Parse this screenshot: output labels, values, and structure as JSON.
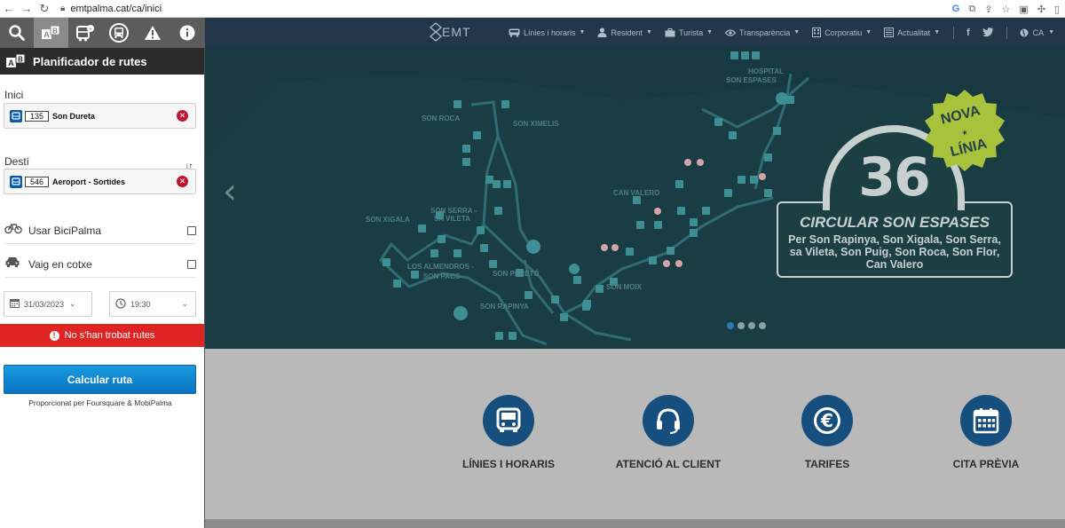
{
  "browser": {
    "url": "emtpalma.cat/ca/inici"
  },
  "panel": {
    "title": "Planificador de rutes",
    "origin": {
      "label": "Inici",
      "code": "135",
      "name": "Son Dureta"
    },
    "destination": {
      "label": "Destí",
      "code": "546",
      "name": "Aeroport - Sortides"
    },
    "options": [
      {
        "label": "Usar BiciPalma",
        "icon": "bicycle-icon"
      },
      {
        "label": "Vaig en cotxe",
        "icon": "car-icon"
      }
    ],
    "date": "31/03/2023",
    "time": "19:30",
    "error": "No s'han trobat rutes",
    "calc_button": "Calcular ruta",
    "credits": "Proporcionat per Foursquare & MobiPalma"
  },
  "site_nav": {
    "logo": "EMT",
    "items": [
      {
        "label": "Línies i horaris"
      },
      {
        "label": "Resident"
      },
      {
        "label": "Turista"
      },
      {
        "label": "Transparència"
      },
      {
        "label": "Corporatiu"
      },
      {
        "label": "Actualitat"
      }
    ],
    "language": "CA"
  },
  "hero": {
    "map_labels": [
      "HOSPITAL SON ESPASES",
      "SON ROCA",
      "SON XIMELIS",
      "CAN VALERO",
      "SON SERRA - SA VILETA",
      "SON XIGALA",
      "LOS ALMENDROS - SON PACS",
      "SON PERETÓ",
      "SON MOIX",
      "SON RAPINYA"
    ],
    "badge_line1": "NOVA",
    "badge_line2": "LÍNIA",
    "line_number": "36",
    "promo_title": "CIRCULAR SON ESPASES",
    "promo_sub": "Per Son Rapinya, Son Xigala, Son Serra, sa Vileta, Son Puig, Son Roca, Son Flor, Can Valero",
    "slides": 4,
    "active_slide": 1
  },
  "services": [
    {
      "label": "LÍNIES I HORARIS",
      "icon": "bus-icon"
    },
    {
      "label": "ATENCIÓ AL CLIENT",
      "icon": "headset-icon"
    },
    {
      "label": "TARIFES",
      "icon": "euro-icon"
    },
    {
      "label": "CITA PRÈVIA",
      "icon": "calendar-icon"
    }
  ],
  "colors": {
    "nav_bg": "#22384a",
    "panel_header": "#2b2b2b",
    "error": "#e02424",
    "primary_button": "#1a8fd8",
    "service_circle": "#164e7e",
    "hero_bg": "#17393f",
    "badge": "#a9c23b"
  }
}
